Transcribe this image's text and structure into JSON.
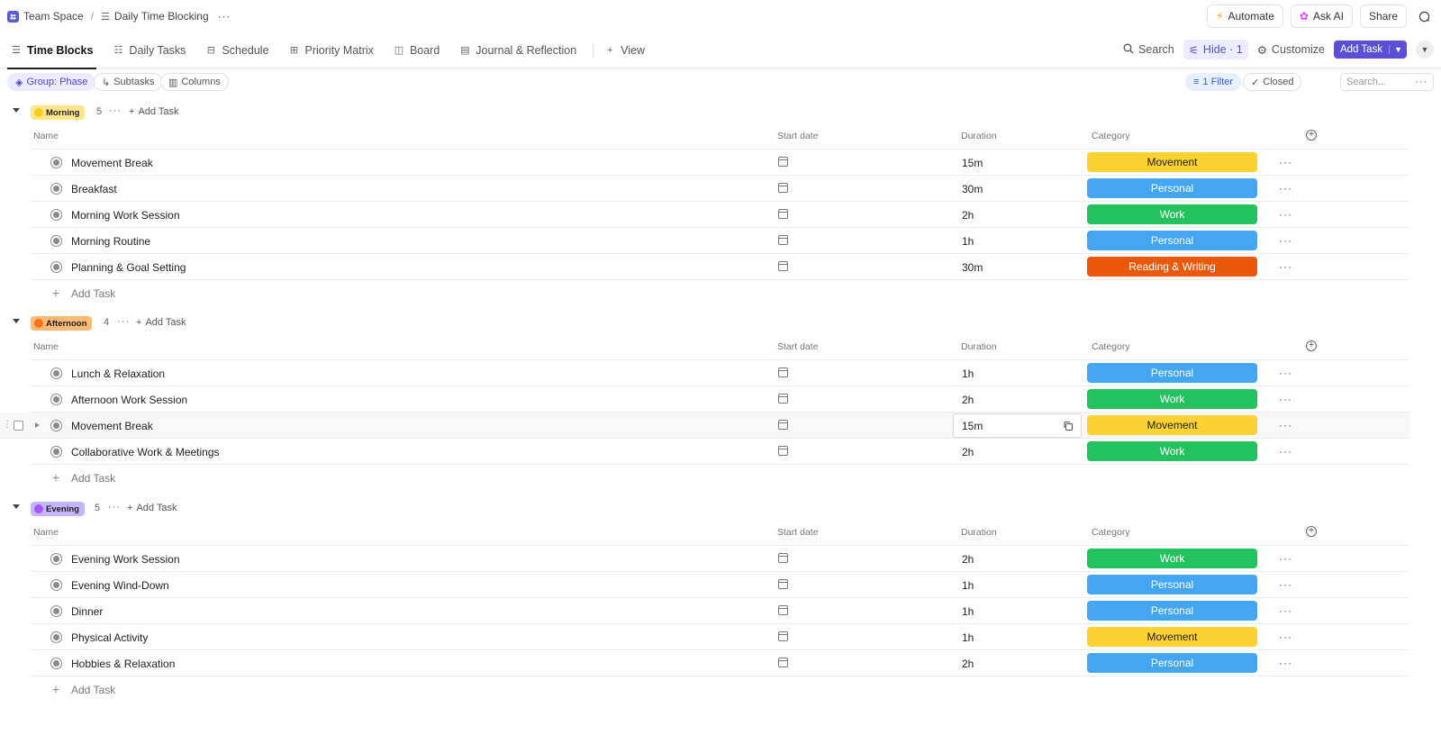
{
  "breadcrumb": {
    "space": "Team Space",
    "separator": "/",
    "list": "Daily Time Blocking"
  },
  "top_actions": {
    "automate": "Automate",
    "ask_ai": "Ask AI",
    "share": "Share"
  },
  "tabs": [
    {
      "label": "Time Blocks",
      "icon": "list-icon",
      "active": true
    },
    {
      "label": "Daily Tasks",
      "icon": "checklist-icon"
    },
    {
      "label": "Schedule",
      "icon": "gantt-icon"
    },
    {
      "label": "Priority Matrix",
      "icon": "matrix-icon"
    },
    {
      "label": "Board",
      "icon": "board-icon"
    },
    {
      "label": "Journal & Reflection",
      "icon": "doc-icon"
    }
  ],
  "add_view": "View",
  "toolbar": {
    "search": "Search",
    "hide": "Hide · 1",
    "customize": "Customize",
    "add_task": "Add Task"
  },
  "filters": {
    "group": "Group: Phase",
    "subtasks": "Subtasks",
    "columns": "Columns",
    "filter": "1 Filter",
    "closed": "Closed",
    "search_placeholder": "Search..."
  },
  "columns": {
    "name": "Name",
    "start_date": "Start date",
    "duration": "Duration",
    "category": "Category"
  },
  "add_task_label": "Add Task",
  "category_colors": {
    "Movement": "#fcd232",
    "Personal": "#44a6f0",
    "Work": "#22c35e",
    "Reading & Writing": "#ea580c"
  },
  "groups": [
    {
      "name": "Morning",
      "count": "5",
      "badge_bg": "#fde68a",
      "dot": "#facc15",
      "tasks": [
        {
          "name": "Movement Break",
          "duration": "15m",
          "category": "Movement"
        },
        {
          "name": "Breakfast",
          "duration": "30m",
          "category": "Personal"
        },
        {
          "name": "Morning Work Session",
          "duration": "2h",
          "category": "Work"
        },
        {
          "name": "Morning Routine",
          "duration": "1h",
          "category": "Personal"
        },
        {
          "name": "Planning & Goal Setting",
          "duration": "30m",
          "category": "Reading & Writing"
        }
      ]
    },
    {
      "name": "Afternoon",
      "count": "4",
      "badge_bg": "#fdba74",
      "dot": "#f97316",
      "tasks": [
        {
          "name": "Lunch & Relaxation",
          "duration": "1h",
          "category": "Personal"
        },
        {
          "name": "Afternoon Work Session",
          "duration": "2h",
          "category": "Work"
        },
        {
          "name": "Movement Break",
          "duration": "15m",
          "category": "Movement",
          "hover": true
        },
        {
          "name": "Collaborative Work & Meetings",
          "duration": "2h",
          "category": "Work"
        }
      ]
    },
    {
      "name": "Evening",
      "count": "5",
      "badge_bg": "#c4b5fd",
      "dot": "#a855f7",
      "tasks": [
        {
          "name": "Evening Work Session",
          "duration": "2h",
          "category": "Work"
        },
        {
          "name": "Evening Wind-Down",
          "duration": "1h",
          "category": "Personal"
        },
        {
          "name": "Dinner",
          "duration": "1h",
          "category": "Personal"
        },
        {
          "name": "Physical Activity",
          "duration": "1h",
          "category": "Movement"
        },
        {
          "name": "Hobbies & Relaxation",
          "duration": "2h",
          "category": "Personal"
        }
      ]
    }
  ]
}
